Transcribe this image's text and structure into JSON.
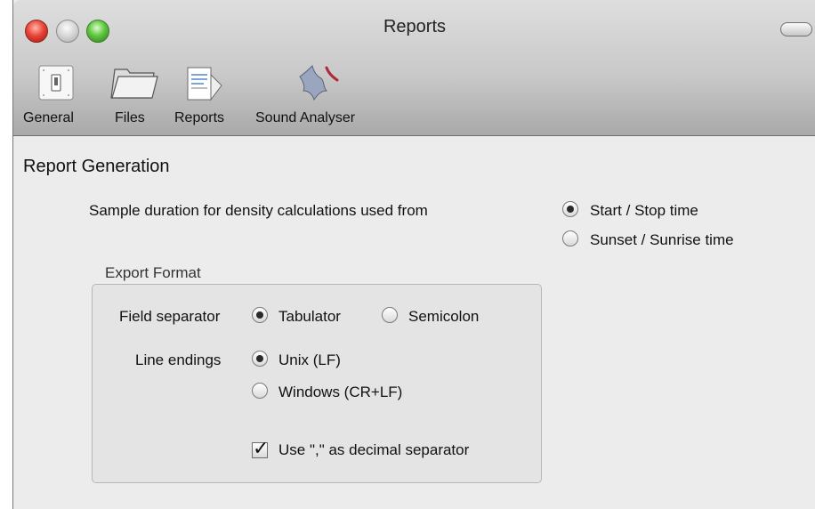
{
  "window": {
    "title": "Reports"
  },
  "toolbar": {
    "items": [
      {
        "label": "General",
        "icon": "switch-icon"
      },
      {
        "label": "Files",
        "icon": "folder-icon"
      },
      {
        "label": "Reports",
        "icon": "report-document-icon"
      },
      {
        "label": "Sound Analyser",
        "icon": "bat-icon"
      }
    ]
  },
  "section": {
    "title": "Report Generation",
    "sample_duration_label": "Sample duration for density calculations used from",
    "options": [
      {
        "label": "Start / Stop time",
        "selected": true
      },
      {
        "label": "Sunset / Sunrise time",
        "selected": false
      }
    ]
  },
  "export": {
    "title": "Export Format",
    "field_separator_label": "Field separator",
    "field_separator_options": [
      {
        "label": "Tabulator",
        "selected": true
      },
      {
        "label": "Semicolon",
        "selected": false
      }
    ],
    "line_endings_label": "Line endings",
    "line_endings_options": [
      {
        "label": "Unix (LF)",
        "selected": true
      },
      {
        "label": "Windows (CR+LF)",
        "selected": false
      }
    ],
    "decimal_checkbox": {
      "label": "Use \",\" as decimal separator",
      "checked": true
    }
  }
}
